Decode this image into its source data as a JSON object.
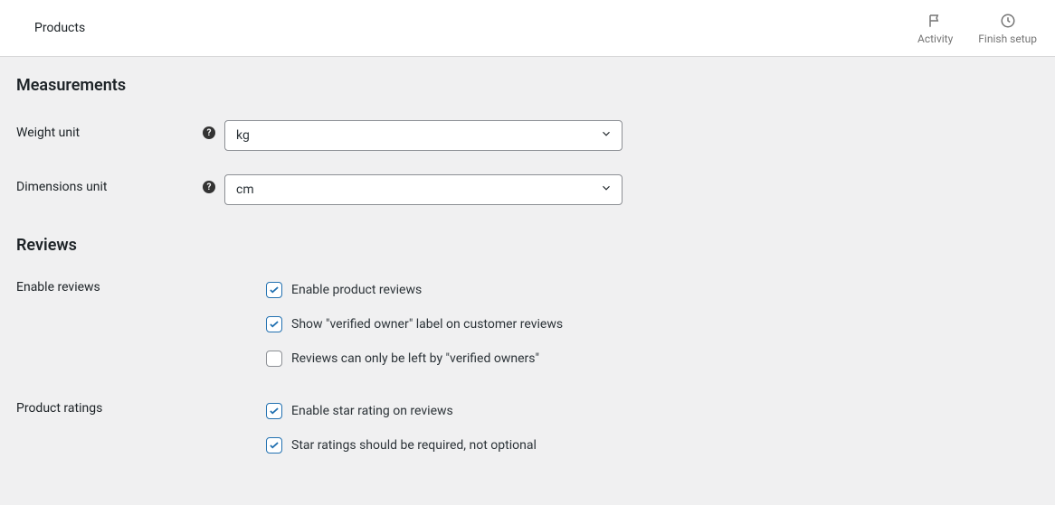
{
  "header": {
    "title": "Products",
    "activity_label": "Activity",
    "finish_label": "Finish setup"
  },
  "sections": {
    "measurements_title": "Measurements",
    "reviews_title": "Reviews"
  },
  "measurements": {
    "weight_label": "Weight unit",
    "weight_value": "kg",
    "dimensions_label": "Dimensions unit",
    "dimensions_value": "cm"
  },
  "reviews": {
    "enable_label": "Enable reviews",
    "enable_opt1": "Enable product reviews",
    "enable_opt1_checked": true,
    "enable_opt2": "Show \"verified owner\" label on customer reviews",
    "enable_opt2_checked": true,
    "enable_opt3": "Reviews can only be left by \"verified owners\"",
    "enable_opt3_checked": false,
    "ratings_label": "Product ratings",
    "ratings_opt1": "Enable star rating on reviews",
    "ratings_opt1_checked": true,
    "ratings_opt2": "Star ratings should be required, not optional",
    "ratings_opt2_checked": true
  }
}
